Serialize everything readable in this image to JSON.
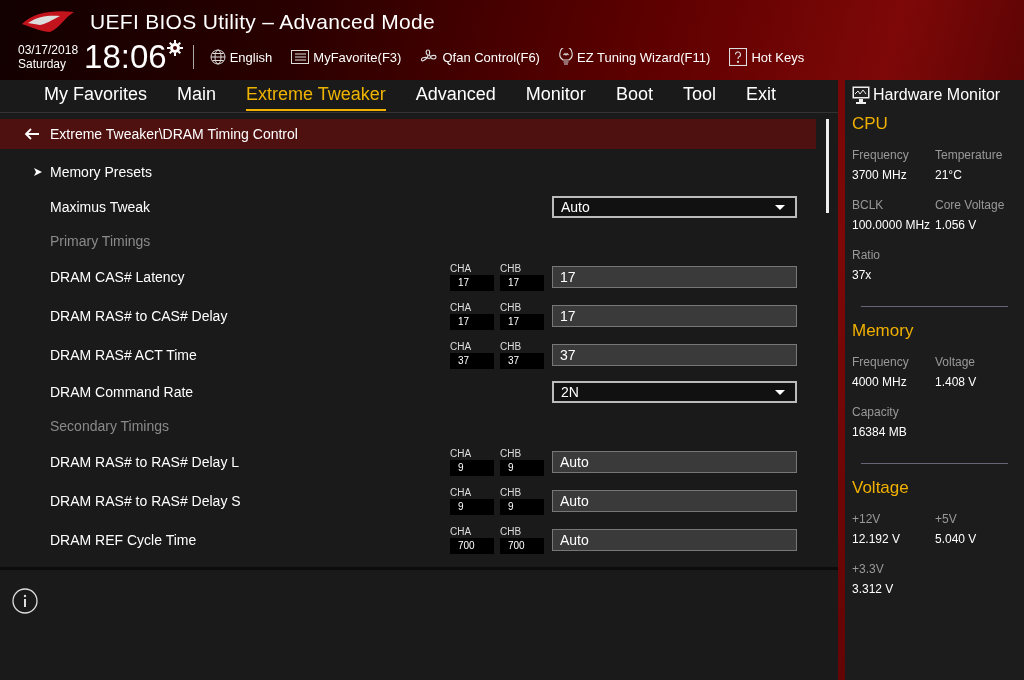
{
  "window": {
    "title": "UEFI BIOS Utility – Advanced Mode"
  },
  "header": {
    "date": "03/17/2018",
    "day": "Saturday",
    "time": "18:06",
    "toolbar": [
      {
        "kind": "globe",
        "label": "English"
      },
      {
        "kind": "favorites",
        "label": "MyFavorite(F3)"
      },
      {
        "kind": "fan",
        "label": "Qfan Control(F6)"
      },
      {
        "kind": "bulb",
        "label": "EZ Tuning Wizard(F11)"
      },
      {
        "kind": "help",
        "label": "Hot Keys"
      }
    ]
  },
  "tabs": [
    {
      "label": "My Favorites",
      "selected": false
    },
    {
      "label": "Main",
      "selected": false
    },
    {
      "label": "Extreme Tweaker",
      "selected": true
    },
    {
      "label": "Advanced",
      "selected": false
    },
    {
      "label": "Monitor",
      "selected": false
    },
    {
      "label": "Boot",
      "selected": false
    },
    {
      "label": "Tool",
      "selected": false
    },
    {
      "label": "Exit",
      "selected": false
    }
  ],
  "breadcrumb": "Extreme Tweaker\\DRAM Timing Control",
  "rows": [
    {
      "kind": "submenu",
      "label": "Memory Presets"
    },
    {
      "kind": "dropdown",
      "label": "Maximus Tweak",
      "value": "Auto"
    },
    {
      "kind": "heading",
      "label": "Primary Timings"
    },
    {
      "kind": "input",
      "label": "DRAM CAS# Latency",
      "channels": [
        {
          "label": "CHA",
          "value": "17"
        },
        {
          "label": "CHB",
          "value": "17"
        }
      ],
      "value": "17"
    },
    {
      "kind": "input",
      "label": "DRAM RAS# to CAS# Delay",
      "channels": [
        {
          "label": "CHA",
          "value": "17"
        },
        {
          "label": "CHB",
          "value": "17"
        }
      ],
      "value": "17"
    },
    {
      "kind": "input",
      "label": "DRAM RAS# ACT Time",
      "channels": [
        {
          "label": "CHA",
          "value": "37"
        },
        {
          "label": "CHB",
          "value": "37"
        }
      ],
      "value": "37"
    },
    {
      "kind": "dropdown",
      "label": "DRAM Command Rate",
      "value": "2N"
    },
    {
      "kind": "heading",
      "label": "Secondary Timings"
    },
    {
      "kind": "input",
      "label": "DRAM RAS# to RAS# Delay L",
      "channels": [
        {
          "label": "CHA",
          "value": "9"
        },
        {
          "label": "CHB",
          "value": "9"
        }
      ],
      "value": "Auto"
    },
    {
      "kind": "input",
      "label": "DRAM RAS# to RAS# Delay S",
      "channels": [
        {
          "label": "CHA",
          "value": "9"
        },
        {
          "label": "CHB",
          "value": "9"
        }
      ],
      "value": "Auto"
    },
    {
      "kind": "input",
      "label": "DRAM REF Cycle Time",
      "channels": [
        {
          "label": "CHA",
          "value": "700"
        },
        {
          "label": "CHB",
          "value": "700"
        }
      ],
      "value": "Auto"
    }
  ],
  "hardware_monitor": {
    "title": "Hardware Monitor",
    "sections": [
      {
        "title": "CPU",
        "items": [
          {
            "label": "Frequency",
            "value": "3700 MHz"
          },
          {
            "label": "Temperature",
            "value": "21°C"
          },
          {
            "label": "BCLK",
            "value": "100.0000 MHz"
          },
          {
            "label": "Core Voltage",
            "value": "1.056 V"
          },
          {
            "label": "Ratio",
            "value": "37x"
          }
        ]
      },
      {
        "title": "Memory",
        "items": [
          {
            "label": "Frequency",
            "value": "4000 MHz"
          },
          {
            "label": "Voltage",
            "value": "1.408 V"
          },
          {
            "label": "Capacity",
            "value": "16384 MB"
          }
        ]
      },
      {
        "title": "Voltage",
        "items": [
          {
            "label": "+12V",
            "value": "12.192 V"
          },
          {
            "label": "+5V",
            "value": "5.040 V"
          },
          {
            "label": "+3.3V",
            "value": "3.312 V"
          }
        ]
      }
    ]
  }
}
